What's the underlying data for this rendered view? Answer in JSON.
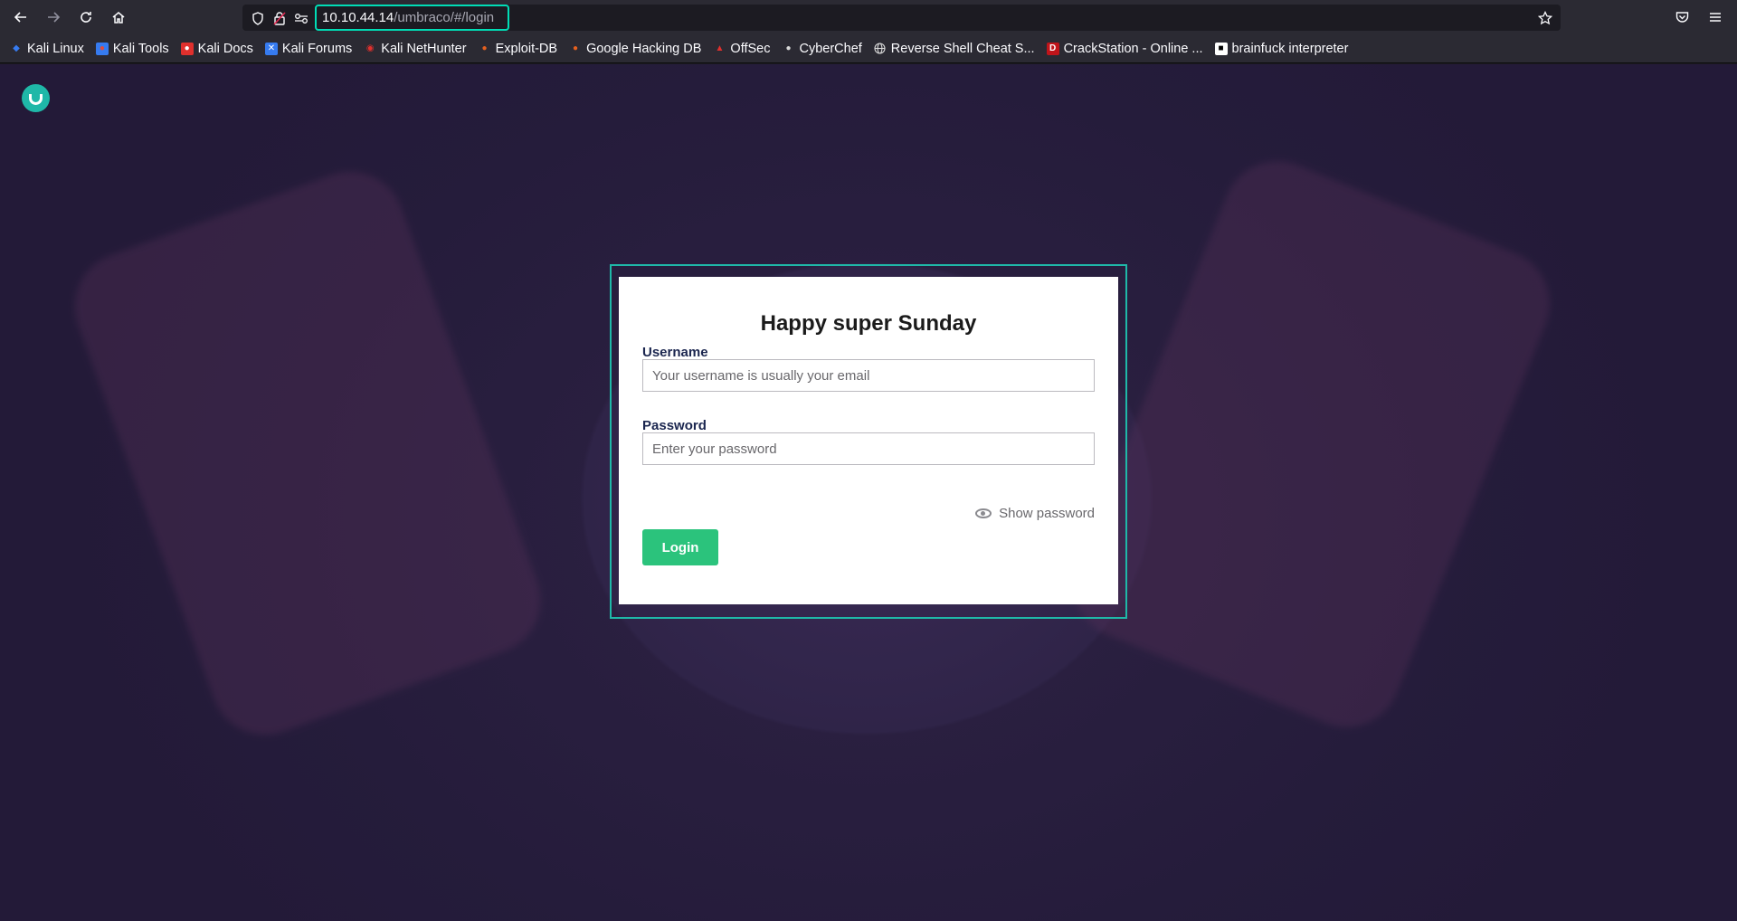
{
  "browser": {
    "nav": {
      "back_icon": "arrow-left-icon",
      "forward_icon": "arrow-right-icon",
      "reload_icon": "reload-icon",
      "home_icon": "home-icon"
    },
    "url": {
      "host": "10.10.44.14",
      "path": "/umbraco/#/login"
    },
    "right_icons": [
      "star-icon",
      "pocket-icon",
      "menu-icon"
    ]
  },
  "bookmarks": [
    {
      "label": "Kali Linux",
      "color": "#367bf0"
    },
    {
      "label": "Kali Tools",
      "color": "#e14c3c"
    },
    {
      "label": "Kali Docs",
      "color": "#e0302d"
    },
    {
      "label": "Kali Forums",
      "color": "#367bf0"
    },
    {
      "label": "Kali NetHunter",
      "color": "#e0302d"
    },
    {
      "label": "Exploit-DB",
      "color": "#e5601f"
    },
    {
      "label": "Google Hacking DB",
      "color": "#e5601f"
    },
    {
      "label": "OffSec",
      "color": "#e0302d"
    },
    {
      "label": "CyberChef",
      "color": "#d9d9d9"
    },
    {
      "label": "Reverse Shell Cheat S...",
      "color": "#d9d9d9"
    },
    {
      "label": "CrackStation - Online ...",
      "color": "#c0141a"
    },
    {
      "label": "brainfuck interpreter",
      "color": "#ffffff"
    }
  ],
  "login": {
    "title": "Happy super Sunday",
    "username_label": "Username",
    "username_placeholder": "Your username is usually your email",
    "password_label": "Password",
    "password_placeholder": "Enter your password",
    "show_password": "Show password",
    "login_button": "Login"
  },
  "colors": {
    "accent": "#1fb8a8",
    "button": "#2bc37c"
  }
}
